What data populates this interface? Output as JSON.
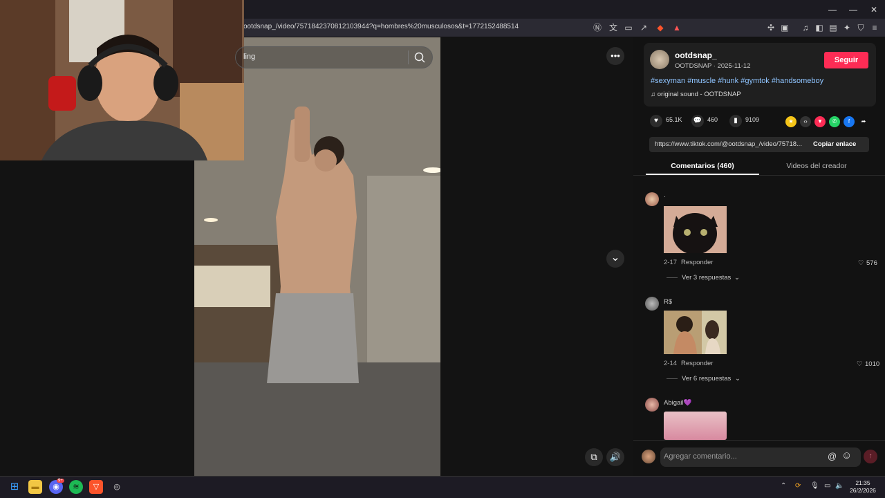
{
  "browser": {
    "url": "ootdsnap_/video/7571842370812103944?q=hombres%20musculosos&t=1772152488514",
    "window": {
      "minimize": "—",
      "restore": "❐",
      "close": "✕"
    }
  },
  "search": {
    "text": "ling"
  },
  "video": {
    "more_label": "•••",
    "scroll_down_label": "⌄"
  },
  "post": {
    "author": "ootdsnap_",
    "author_sub": "OOTDSNAP · 2025-11-12",
    "follow_label": "Seguir",
    "tags": "#sexyman #muscle #hunk #gymtok #handsomeboy",
    "sound": "♫  original sound - OOTDSNAP",
    "likes": "65.1K",
    "comments": "460",
    "saves": "9109",
    "link": "https://www.tiktok.com/@ootdsnap_/video/75718...",
    "copy_label": "Copiar enlace"
  },
  "tabs": {
    "comments": "Comentarios (460)",
    "videos": "Videos del creador"
  },
  "comments": [
    {
      "name": "·",
      "date": "2-17",
      "reply_label": "Responder",
      "likes": "576",
      "replies": "Ver 3 respuestas"
    },
    {
      "name": "R$",
      "date": "2-14",
      "reply_label": "Responder",
      "likes": "1010",
      "replies": "Ver 6 respuestas"
    },
    {
      "name": "Abigail💜",
      "date": "",
      "reply_label": "",
      "likes": "",
      "replies": ""
    }
  ],
  "comment_box": {
    "placeholder": "Agregar comentario...",
    "at": "@",
    "emoji": "☺",
    "send": "↑"
  },
  "taskbar": {
    "time": "21:35",
    "date": "26/2/2026",
    "discord_badge": "9+"
  },
  "colors": {
    "accent": "#fe2c55",
    "hashtag": "#8fc4ff",
    "panel": "#121212"
  }
}
